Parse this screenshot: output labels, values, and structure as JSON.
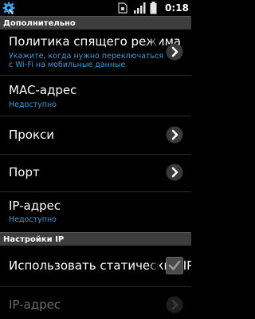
{
  "statusbar": {
    "time": "0:18"
  },
  "sections": {
    "advanced_header": "Дополнительно",
    "ip_header": "Настройки IP"
  },
  "items": {
    "sleep_policy": {
      "title": "Политика спящего режима",
      "summary_line1": "Укажите, когда нужно переключаться",
      "summary_line2": "с Wi-Fi на мобильные данные"
    },
    "mac": {
      "title": "MAC-адрес",
      "summary": "Недоступно"
    },
    "proxy": {
      "title": "Прокси"
    },
    "port": {
      "title": "Порт"
    },
    "ip": {
      "title": "IP-адрес",
      "summary": "Недоступно"
    },
    "use_static": {
      "title": "Использовать статический IP",
      "checked": true
    },
    "ip_disabled": {
      "title": "IP-адрес"
    }
  },
  "icons": {
    "statusbar_left": "settings-gear-icon",
    "chevron": "chevron-right-circle-icon",
    "checkbox": "checkbox-checked-icon"
  },
  "colors": {
    "summary": "#3f9bd9",
    "section_bg": "#3d3d3d",
    "background": "#000000"
  }
}
